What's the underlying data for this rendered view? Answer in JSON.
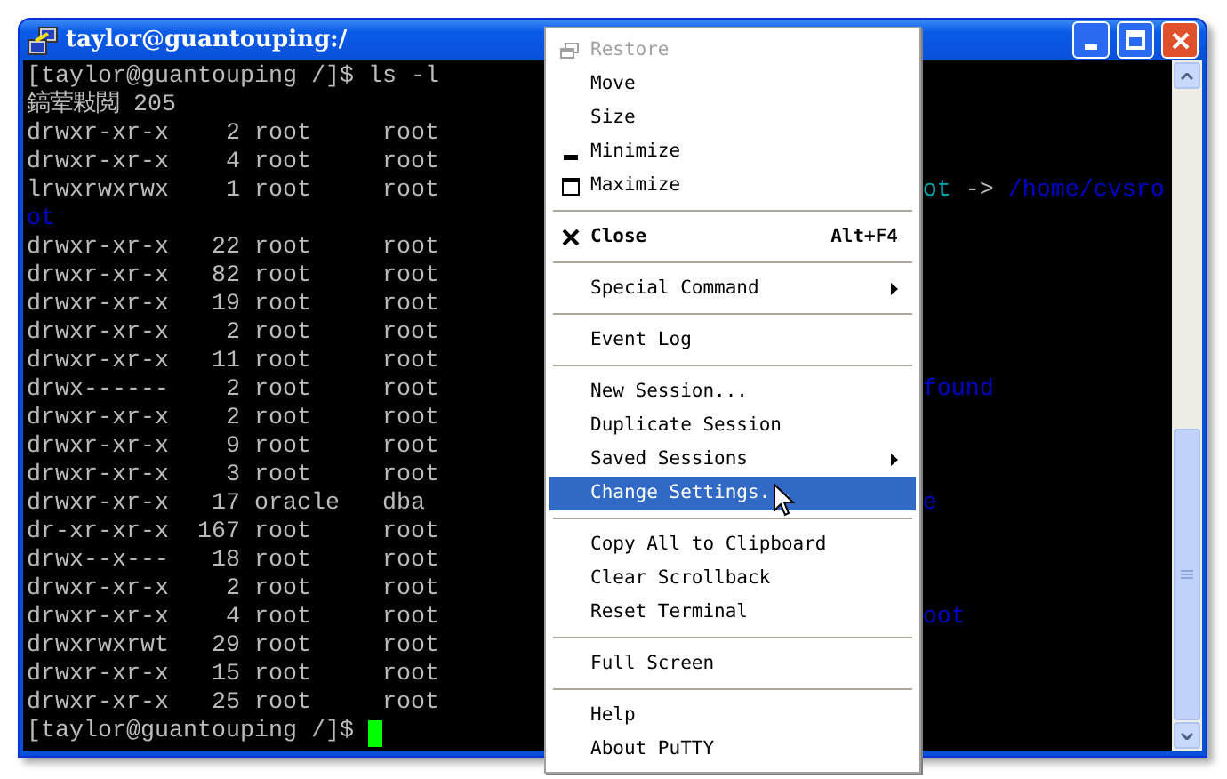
{
  "window": {
    "title": "taylor@guantouping:/"
  },
  "terminal": {
    "lines": [
      {
        "text": "[taylor@guantouping /]$ ls -l"
      },
      {
        "text": "鎬荤敤閲 205"
      },
      {
        "text": "drwxr-xr-x    2 root     root"
      },
      {
        "text": "drwxr-xr-x    4 root     root"
      },
      {
        "text": "lrwxrwxrwx    1 root     root",
        "tail": [
          {
            "text": "ot",
            "color": "#00aaaa"
          },
          {
            "text": " -> ",
            "color": "#bbbbbb"
          },
          {
            "text": "/home/cvsro",
            "color": "#0000cc"
          }
        ]
      },
      {
        "text": "ot",
        "color": "#0000cc"
      },
      {
        "text": "drwxr-xr-x   22 root     root"
      },
      {
        "text": "drwxr-xr-x   82 root     root"
      },
      {
        "text": "drwxr-xr-x   19 root     root"
      },
      {
        "text": "drwxr-xr-x    2 root     root"
      },
      {
        "text": "drwxr-xr-x   11 root     root"
      },
      {
        "text": "drwx------    2 root     root",
        "tail": [
          {
            "text": "found",
            "color": "#0000cc"
          }
        ]
      },
      {
        "text": "drwxr-xr-x    2 root     root"
      },
      {
        "text": "drwxr-xr-x    9 root     root"
      },
      {
        "text": "drwxr-xr-x    3 root     root"
      },
      {
        "text": "drwxr-xr-x   17 oracle   dba",
        "tail": [
          {
            "text": "e",
            "color": "#0000cc"
          }
        ]
      },
      {
        "text": "dr-xr-xr-x  167 root     root"
      },
      {
        "text": "drwx--x---   18 root     root"
      },
      {
        "text": "drwxr-xr-x    2 root     root"
      },
      {
        "text": "drwxr-xr-x    4 root     root",
        "tail": [
          {
            "text": "oot",
            "color": "#0000cc"
          }
        ]
      },
      {
        "text": "drwxrwxrwt   29 root     root"
      },
      {
        "text": "drwxr-xr-x   15 root     root"
      },
      {
        "text": "drwxr-xr-x   25 root     root"
      },
      {
        "text": "[taylor@guantouping /]$ ",
        "cursor": true
      }
    ]
  },
  "menu": {
    "items": [
      {
        "kind": "restore",
        "label": "Restore",
        "disabled": true,
        "selected": false
      },
      {
        "kind": "item",
        "label": "Move",
        "disabled": false,
        "selected": false
      },
      {
        "kind": "item",
        "label": "Size",
        "disabled": false,
        "selected": false
      },
      {
        "kind": "minimize",
        "label": "Minimize",
        "disabled": false,
        "selected": false
      },
      {
        "kind": "maximize",
        "label": "Maximize",
        "disabled": false,
        "selected": false
      },
      {
        "kind": "separator"
      },
      {
        "kind": "close",
        "label": "Close",
        "bold": true,
        "shortcut": "Alt+F4",
        "disabled": false,
        "selected": false
      },
      {
        "kind": "separator"
      },
      {
        "kind": "item",
        "label": "Special Command",
        "submenu": true,
        "disabled": false,
        "selected": false
      },
      {
        "kind": "separator"
      },
      {
        "kind": "item",
        "label": "Event Log",
        "disabled": false,
        "selected": false
      },
      {
        "kind": "separator"
      },
      {
        "kind": "item",
        "label": "New Session...",
        "disabled": false,
        "selected": false
      },
      {
        "kind": "item",
        "label": "Duplicate Session",
        "disabled": false,
        "selected": false
      },
      {
        "kind": "item",
        "label": "Saved Sessions",
        "submenu": true,
        "disabled": false,
        "selected": false
      },
      {
        "kind": "item",
        "label": "Change Settings...",
        "disabled": false,
        "selected": true
      },
      {
        "kind": "separator"
      },
      {
        "kind": "item",
        "label": "Copy All to Clipboard",
        "disabled": false,
        "selected": false
      },
      {
        "kind": "item",
        "label": "Clear Scrollback",
        "disabled": false,
        "selected": false
      },
      {
        "kind": "item",
        "label": "Reset Terminal",
        "disabled": false,
        "selected": false
      },
      {
        "kind": "separator"
      },
      {
        "kind": "item",
        "label": "Full Screen",
        "disabled": false,
        "selected": false
      },
      {
        "kind": "separator"
      },
      {
        "kind": "item",
        "label": "Help",
        "disabled": false,
        "selected": false
      },
      {
        "kind": "item",
        "label": "About PuTTY",
        "disabled": false,
        "selected": false
      }
    ]
  }
}
